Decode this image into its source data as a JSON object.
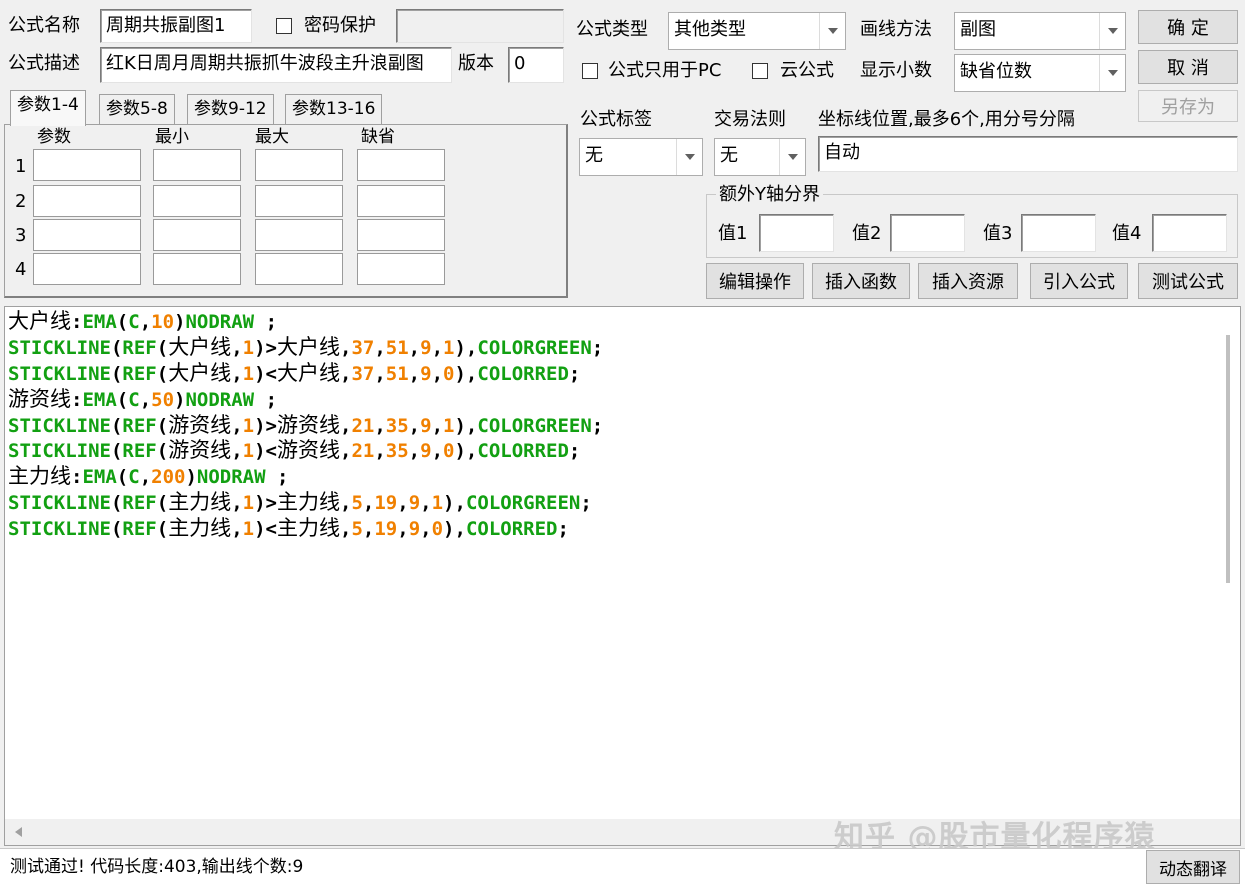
{
  "header": {
    "formula_name_label": "公式名称",
    "formula_name_value": "周期共振副图1",
    "password_protect_label": "密码保护",
    "formula_desc_label": "公式描述",
    "formula_desc_value": "红K日周月周期共振抓牛波段主升浪副图",
    "version_label": "版本",
    "version_value": "0",
    "formula_type_label": "公式类型",
    "formula_type_value": "其他类型",
    "draw_method_label": "画线方法",
    "draw_method_value": "副图",
    "pc_only_label": "公式只用于PC",
    "cloud_formula_label": "云公式",
    "decimals_label": "显示小数",
    "decimals_value": "缺省位数",
    "ok_label": "确  定",
    "cancel_label": "取  消",
    "save_as_label": "另存为"
  },
  "params": {
    "tabs": [
      "参数1-4",
      "参数5-8",
      "参数9-12",
      "参数13-16"
    ],
    "columns": [
      "参数",
      "最小",
      "最大",
      "缺省"
    ],
    "rows": [
      "1",
      "2",
      "3",
      "4"
    ]
  },
  "right_panel": {
    "tag_label": "公式标签",
    "tag_value": "无",
    "trade_rule_label": "交易法则",
    "trade_rule_value": "无",
    "coord_label": "坐标线位置,最多6个,用分号分隔",
    "coord_value": "自动",
    "extra_y_label": "额外Y轴分界",
    "value_labels": [
      "值1",
      "值2",
      "值3",
      "值4"
    ],
    "buttons": [
      "编辑操作",
      "插入函数",
      "插入资源",
      "引入公式",
      "测试公式"
    ]
  },
  "code_lines": [
    [
      [
        "cn",
        "大户线"
      ],
      [
        "pn",
        ":"
      ],
      [
        "kw",
        "EMA"
      ],
      [
        "pn",
        "("
      ],
      [
        "kw",
        "C"
      ],
      [
        "pn",
        ","
      ],
      [
        "num",
        "10"
      ],
      [
        "pn",
        ")"
      ],
      [
        "kw",
        "NODRAW"
      ],
      [
        "pn",
        " ;"
      ]
    ],
    [
      [
        "kw",
        "STICKLINE"
      ],
      [
        "pn",
        "("
      ],
      [
        "kw",
        "REF"
      ],
      [
        "pn",
        "("
      ],
      [
        "cn",
        "大户线"
      ],
      [
        "pn",
        ","
      ],
      [
        "num",
        "1"
      ],
      [
        "pn",
        ")>"
      ],
      [
        "cn",
        "大户线"
      ],
      [
        "pn",
        ","
      ],
      [
        "num",
        "37"
      ],
      [
        "pn",
        ","
      ],
      [
        "num",
        "51"
      ],
      [
        "pn",
        ","
      ],
      [
        "num",
        "9"
      ],
      [
        "pn",
        ","
      ],
      [
        "num",
        "1"
      ],
      [
        "pn",
        "),"
      ],
      [
        "kw",
        "COLORGREEN"
      ],
      [
        "pn",
        ";"
      ]
    ],
    [
      [
        "kw",
        "STICKLINE"
      ],
      [
        "pn",
        "("
      ],
      [
        "kw",
        "REF"
      ],
      [
        "pn",
        "("
      ],
      [
        "cn",
        "大户线"
      ],
      [
        "pn",
        ","
      ],
      [
        "num",
        "1"
      ],
      [
        "pn",
        ")<"
      ],
      [
        "cn",
        "大户线"
      ],
      [
        "pn",
        ","
      ],
      [
        "num",
        "37"
      ],
      [
        "pn",
        ","
      ],
      [
        "num",
        "51"
      ],
      [
        "pn",
        ","
      ],
      [
        "num",
        "9"
      ],
      [
        "pn",
        ","
      ],
      [
        "num",
        "0"
      ],
      [
        "pn",
        "),"
      ],
      [
        "kw",
        "COLORRED"
      ],
      [
        "pn",
        ";"
      ]
    ],
    [
      [
        "cn",
        "游资线"
      ],
      [
        "pn",
        ":"
      ],
      [
        "kw",
        "EMA"
      ],
      [
        "pn",
        "("
      ],
      [
        "kw",
        "C"
      ],
      [
        "pn",
        ","
      ],
      [
        "num",
        "50"
      ],
      [
        "pn",
        ")"
      ],
      [
        "kw",
        "NODRAW"
      ],
      [
        "pn",
        " ;"
      ]
    ],
    [
      [
        "kw",
        "STICKLINE"
      ],
      [
        "pn",
        "("
      ],
      [
        "kw",
        "REF"
      ],
      [
        "pn",
        "("
      ],
      [
        "cn",
        "游资线"
      ],
      [
        "pn",
        ","
      ],
      [
        "num",
        "1"
      ],
      [
        "pn",
        ")>"
      ],
      [
        "cn",
        "游资线"
      ],
      [
        "pn",
        ","
      ],
      [
        "num",
        "21"
      ],
      [
        "pn",
        ","
      ],
      [
        "num",
        "35"
      ],
      [
        "pn",
        ","
      ],
      [
        "num",
        "9"
      ],
      [
        "pn",
        ","
      ],
      [
        "num",
        "1"
      ],
      [
        "pn",
        "),"
      ],
      [
        "kw",
        "COLORGREEN"
      ],
      [
        "pn",
        ";"
      ]
    ],
    [
      [
        "kw",
        "STICKLINE"
      ],
      [
        "pn",
        "("
      ],
      [
        "kw",
        "REF"
      ],
      [
        "pn",
        "("
      ],
      [
        "cn",
        "游资线"
      ],
      [
        "pn",
        ","
      ],
      [
        "num",
        "1"
      ],
      [
        "pn",
        ")<"
      ],
      [
        "cn",
        "游资线"
      ],
      [
        "pn",
        ","
      ],
      [
        "num",
        "21"
      ],
      [
        "pn",
        ","
      ],
      [
        "num",
        "35"
      ],
      [
        "pn",
        ","
      ],
      [
        "num",
        "9"
      ],
      [
        "pn",
        ","
      ],
      [
        "num",
        "0"
      ],
      [
        "pn",
        "),"
      ],
      [
        "kw",
        "COLORRED"
      ],
      [
        "pn",
        ";"
      ]
    ],
    [
      [
        "cn",
        "主力线"
      ],
      [
        "pn",
        ":"
      ],
      [
        "kw",
        "EMA"
      ],
      [
        "pn",
        "("
      ],
      [
        "kw",
        "C"
      ],
      [
        "pn",
        ","
      ],
      [
        "num",
        "200"
      ],
      [
        "pn",
        ")"
      ],
      [
        "kw",
        "NODRAW"
      ],
      [
        "pn",
        " ;"
      ]
    ],
    [
      [
        "kw",
        "STICKLINE"
      ],
      [
        "pn",
        "("
      ],
      [
        "kw",
        "REF"
      ],
      [
        "pn",
        "("
      ],
      [
        "cn",
        "主力线"
      ],
      [
        "pn",
        ","
      ],
      [
        "num",
        "1"
      ],
      [
        "pn",
        ")>"
      ],
      [
        "cn",
        "主力线"
      ],
      [
        "pn",
        ","
      ],
      [
        "num",
        "5"
      ],
      [
        "pn",
        ","
      ],
      [
        "num",
        "19"
      ],
      [
        "pn",
        ","
      ],
      [
        "num",
        "9"
      ],
      [
        "pn",
        ","
      ],
      [
        "num",
        "1"
      ],
      [
        "pn",
        "),"
      ],
      [
        "kw",
        "COLORGREEN"
      ],
      [
        "pn",
        ";"
      ]
    ],
    [
      [
        "kw",
        "STICKLINE"
      ],
      [
        "pn",
        "("
      ],
      [
        "kw",
        "REF"
      ],
      [
        "pn",
        "("
      ],
      [
        "cn",
        "主力线"
      ],
      [
        "pn",
        ","
      ],
      [
        "num",
        "1"
      ],
      [
        "pn",
        ")<"
      ],
      [
        "cn",
        "主力线"
      ],
      [
        "pn",
        ","
      ],
      [
        "num",
        "5"
      ],
      [
        "pn",
        ","
      ],
      [
        "num",
        "19"
      ],
      [
        "pn",
        ","
      ],
      [
        "num",
        "9"
      ],
      [
        "pn",
        ","
      ],
      [
        "num",
        "0"
      ],
      [
        "pn",
        "),"
      ],
      [
        "kw",
        "COLORRED"
      ],
      [
        "pn",
        ";"
      ]
    ]
  ],
  "colors": {
    "keyword": "#12a012",
    "number": "#f08000",
    "text": "#000000"
  },
  "status": {
    "message": "测试通过! 代码长度:403,输出线个数:9",
    "translate_button": "动态翻译"
  },
  "watermark": "知乎 @股市量化程序猿_",
  "icons": {
    "scroll_left": "left-arrow-icon",
    "dropdown": "chevron-down-icon"
  }
}
